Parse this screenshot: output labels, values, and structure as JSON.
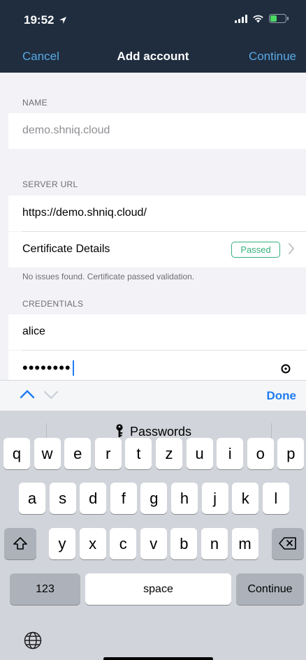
{
  "status": {
    "time": "19:52"
  },
  "nav": {
    "cancel": "Cancel",
    "title": "Add account",
    "continue": "Continue"
  },
  "form": {
    "name_label": "NAME",
    "name_value": "demo.shniq.cloud",
    "server_label": "SERVER URL",
    "server_url": "https://demo.shniq.cloud/",
    "cert_label": "Certificate Details",
    "cert_status": "Passed",
    "cert_note": "No issues found. Certificate passed validation.",
    "cred_label": "CREDENTIALS",
    "username": "alice",
    "password_dots": "••••••••"
  },
  "accessory": {
    "done": "Done"
  },
  "keyboard": {
    "suggestion": "Passwords",
    "row1": [
      "q",
      "w",
      "e",
      "r",
      "t",
      "z",
      "u",
      "i",
      "o",
      "p"
    ],
    "row2": [
      "a",
      "s",
      "d",
      "f",
      "g",
      "h",
      "j",
      "k",
      "l"
    ],
    "row3": [
      "y",
      "x",
      "c",
      "v",
      "b",
      "n",
      "m"
    ],
    "numbers": "123",
    "space": "space",
    "return": "Continue"
  },
  "colors": {
    "nav_bg": "#1f2d3f",
    "accent": "#1e7cf2",
    "passed": "#34b07e"
  }
}
